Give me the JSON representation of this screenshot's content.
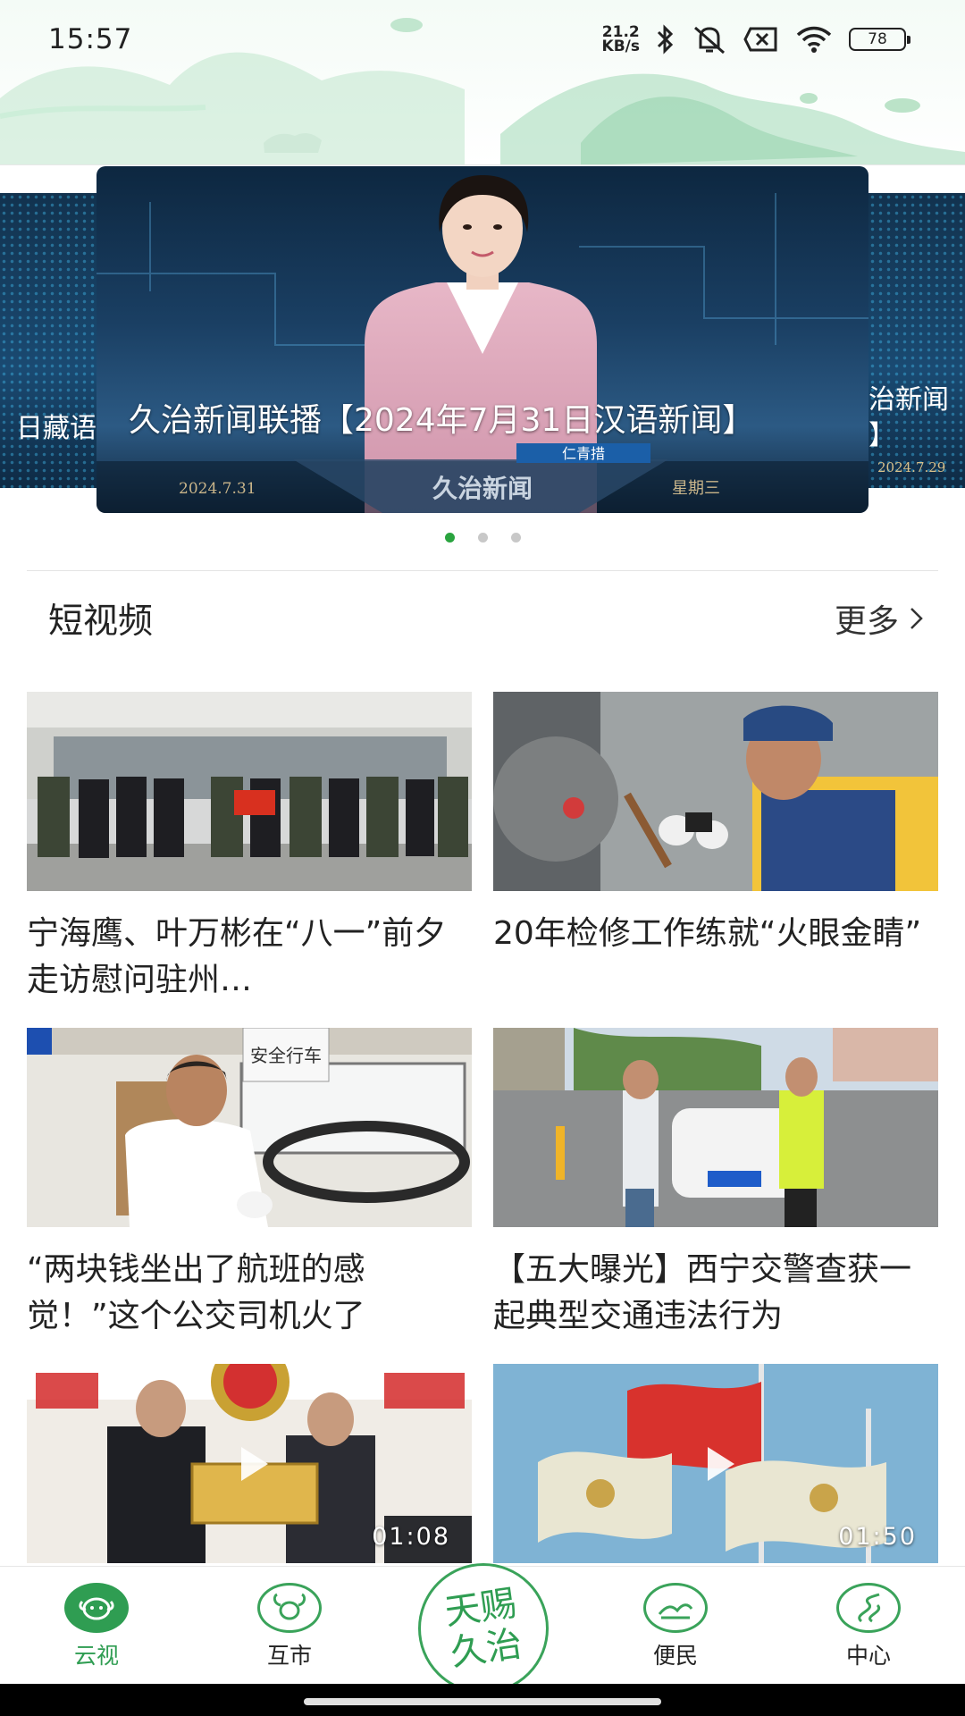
{
  "status_bar": {
    "time": "15:57",
    "net_speed_value": "21.2",
    "net_speed_unit": "KB/s",
    "battery": "78",
    "icons": [
      "bluetooth-icon",
      "mute-icon",
      "sim-off-icon",
      "wifi-icon",
      "battery-icon"
    ]
  },
  "carousel": {
    "main_title": "久治新闻联播【2024年7月31日汉语新闻】",
    "main_logo_text": "久治新闻",
    "main_date": "2024.7.31",
    "main_weekday": "星期三",
    "main_name_tag": "仁青措",
    "left_caption": "日藏语",
    "right_caption": "治新闻",
    "right_caption_line2": "】",
    "right_date": "2024.7.29",
    "dots": 3,
    "active_dot": 0
  },
  "section": {
    "title": "短视频",
    "more_label": "更多"
  },
  "videos": [
    {
      "title": "宁海鹰、叶万彬在“八一”前夕走访慰问驻州…",
      "duration": ""
    },
    {
      "title": "20年检修工作练就“火眼金睛”",
      "duration": ""
    },
    {
      "title": "“两块钱坐出了航班的感觉！”这个公交司机火了",
      "duration": ""
    },
    {
      "title": "【五大曝光】西宁交警查获一起典型交通违法行为",
      "duration": ""
    },
    {
      "title": "",
      "duration": "01:08"
    },
    {
      "title": "",
      "duration": "01:50"
    }
  ],
  "bottom_nav": {
    "items": [
      {
        "label": "云视",
        "icon": "sheep-icon",
        "active": true
      },
      {
        "label": "互市",
        "icon": "yak-icon",
        "active": false
      },
      {
        "label": "便民",
        "icon": "landscape-icon",
        "active": false
      },
      {
        "label": "中心",
        "icon": "road-icon",
        "active": false
      }
    ],
    "center_logo": "天赐久治"
  },
  "colors": {
    "accent": "#2f9d52",
    "dot_active": "#2aa43f"
  }
}
